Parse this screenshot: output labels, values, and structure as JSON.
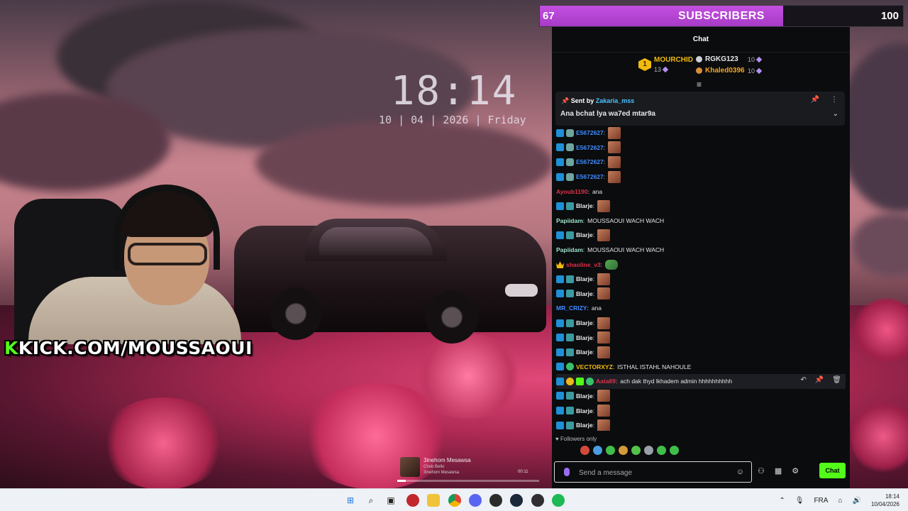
{
  "overlay": {
    "clock_time": "18:14",
    "clock_date": "10 | 04 | 2026 | Friday",
    "channel_banner": "KICK.COM/MOUSSAOUI",
    "channel_banner_k": "K",
    "sub_goal": {
      "current": "67",
      "label": "SUBSCRIBERS",
      "target": "100",
      "progress": 0.67
    },
    "player": {
      "title": "3inehom Mesawsa",
      "artist": "Cheb Bello",
      "subtitle": "3inehom Mesawsa",
      "time": "00:11",
      "progress": 0.06
    }
  },
  "chat": {
    "header": "Chat",
    "leaderboard": [
      {
        "rank": "1",
        "name": "MOURCHID",
        "count": "13",
        "color": "#f2b90f"
      },
      {
        "name": "RGKG123",
        "count": "10",
        "color": "#e8e8e8"
      },
      {
        "name": "Khaled0396",
        "count": "10",
        "color": "#f5a524"
      }
    ],
    "pinned": {
      "sent_by": "Sent by",
      "author": "Zakaria_mss",
      "message": "Ana bchat lya wa7ed mtar9a"
    },
    "messages": [
      {
        "user": "E5672627",
        "color": "#3f8cff",
        "badges": [
          "vip",
          "og"
        ],
        "text": "",
        "emote": true
      },
      {
        "user": "E5672627",
        "color": "#3f8cff",
        "badges": [
          "vip",
          "og"
        ],
        "text": "",
        "emote": true
      },
      {
        "user": "E5672627",
        "color": "#3f8cff",
        "badges": [
          "vip",
          "og"
        ],
        "text": "",
        "emote": true
      },
      {
        "user": "E5672627",
        "color": "#3f8cff",
        "badges": [
          "vip",
          "og"
        ],
        "text": "",
        "emote": true
      },
      {
        "user": "Ayoub1190",
        "color": "#e0304a",
        "badges": [],
        "text": "ana",
        "emote": false
      },
      {
        "user": "Blarje",
        "color": "#e8e8e8",
        "badges": [
          "vip",
          "mod"
        ],
        "text": "",
        "emote": true
      },
      {
        "user": "Papiidam",
        "color": "#9ee3c9",
        "badges": [],
        "text": "MOUSSAOUI WACH WACH",
        "emote": false
      },
      {
        "user": "Blarje",
        "color": "#e8e8e8",
        "badges": [
          "vip",
          "mod"
        ],
        "text": "",
        "emote": true
      },
      {
        "user": "Papiidam",
        "color": "#9ee3c9",
        "badges": [],
        "text": "MOUSSAOUI WACH WACH",
        "emote": false
      },
      {
        "user": "shaoline_v3",
        "color": "#e0304a",
        "badges": [
          "crown"
        ],
        "text": "",
        "emote": false,
        "pepe": true
      },
      {
        "user": "Blarje",
        "color": "#e8e8e8",
        "badges": [
          "vip",
          "mod"
        ],
        "text": "",
        "emote": true
      },
      {
        "user": "Blarje",
        "color": "#e8e8e8",
        "badges": [
          "vip",
          "mod"
        ],
        "text": "",
        "emote": true
      },
      {
        "user": "MR_CRIZY",
        "color": "#3f8cff",
        "badges": [],
        "text": "ana",
        "emote": false
      },
      {
        "user": "Blarje",
        "color": "#e8e8e8",
        "badges": [
          "vip",
          "mod"
        ],
        "text": "",
        "emote": true
      },
      {
        "user": "Blarje",
        "color": "#e8e8e8",
        "badges": [
          "vip",
          "mod"
        ],
        "text": "",
        "emote": true
      },
      {
        "user": "Blarje",
        "color": "#e8e8e8",
        "badges": [
          "vip",
          "mod"
        ],
        "text": "",
        "emote": true
      },
      {
        "user": "VECTORXYZ",
        "color": "#f2b90f",
        "badges": [
          "vip",
          "ver"
        ],
        "text": "ISTHAL ISTAHL NAHOULE",
        "emote": false
      },
      {
        "user": "Aata89",
        "color": "#e0304a",
        "badges": [
          "vip",
          "sub",
          "green",
          "ver"
        ],
        "text": "ach dak thyd lkhadem admin hhhhhhhhhh",
        "emote": false,
        "highlight": true
      },
      {
        "user": "Blarje",
        "color": "#e8e8e8",
        "badges": [
          "vip",
          "mod"
        ],
        "text": "",
        "emote": true
      },
      {
        "user": "Blarje",
        "color": "#e8e8e8",
        "badges": [
          "vip",
          "mod"
        ],
        "text": "",
        "emote": true
      },
      {
        "user": "Blarje",
        "color": "#e8e8e8",
        "badges": [
          "vip",
          "mod"
        ],
        "text": "",
        "emote": true
      }
    ],
    "followers_only": "Followers only",
    "input_placeholder": "Send a message",
    "send_label": "Chat"
  },
  "taskbar": {
    "apps": [
      "windows-start-icon",
      "search-icon",
      "task-view-icon",
      "app-red-icon",
      "file-explorer-icon",
      "chrome-icon",
      "discord-icon",
      "app-g-icon",
      "steam-icon",
      "obs-icon",
      "spotify-icon"
    ],
    "language": "FRA",
    "time": "18:14",
    "date": "10/04/2026"
  }
}
